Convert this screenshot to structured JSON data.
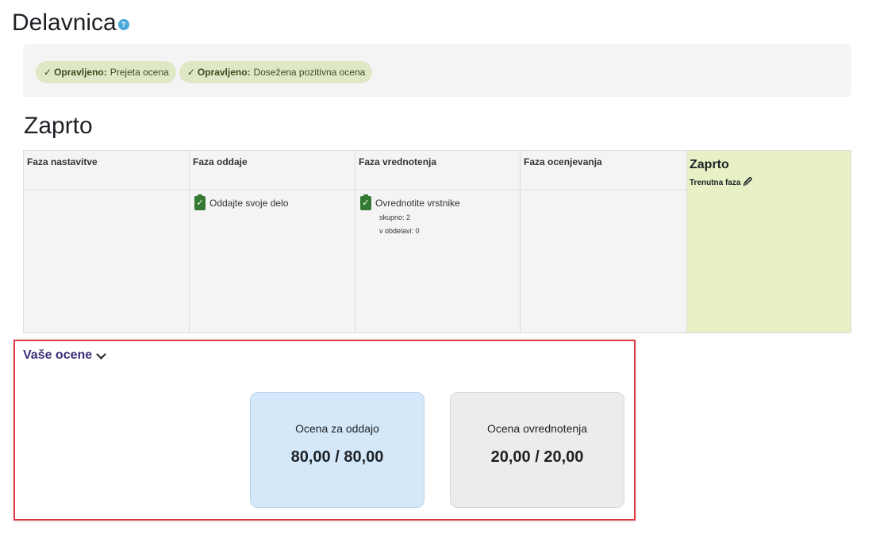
{
  "page": {
    "title": "Delavnica",
    "help_icon": "?"
  },
  "completion": {
    "badges": [
      {
        "status": "Opravljeno:",
        "text": "Prejeta ocena"
      },
      {
        "status": "Opravljeno:",
        "text": "Dosežena pozitivna ocena"
      }
    ]
  },
  "phase_title": "Zaprto",
  "phases": [
    {
      "name": "Faza nastavitve",
      "tasks": []
    },
    {
      "name": "Faza oddaje",
      "tasks": [
        {
          "label": "Oddajte svoje delo",
          "details": []
        }
      ]
    },
    {
      "name": "Faza vrednotenja",
      "tasks": [
        {
          "label": "Ovrednotite vrstnike",
          "details": [
            "skupno: 2",
            "v obdelavi: 0"
          ]
        }
      ]
    },
    {
      "name": "Faza ocenjevanja",
      "tasks": []
    }
  ],
  "active_phase": {
    "name": "Zaprto",
    "label": "Trenutna faza"
  },
  "grades": {
    "toggle_label": "Vaše ocene",
    "submission": {
      "label": "Ocena za oddajo",
      "value": "80,00 / 80,00"
    },
    "assessment": {
      "label": "Ocena ovrednotenja",
      "value": "20,00 / 20,00"
    }
  },
  "colors": {
    "badge_bg": "#dfe8c6",
    "active_phase_bg": "#e8f1c6",
    "task_icon": "#357a32",
    "submission_card": "#d4e8fa",
    "assessment_card": "#ececec",
    "highlight_border": "#e0383e",
    "link_purple": "#3a2f7a"
  }
}
